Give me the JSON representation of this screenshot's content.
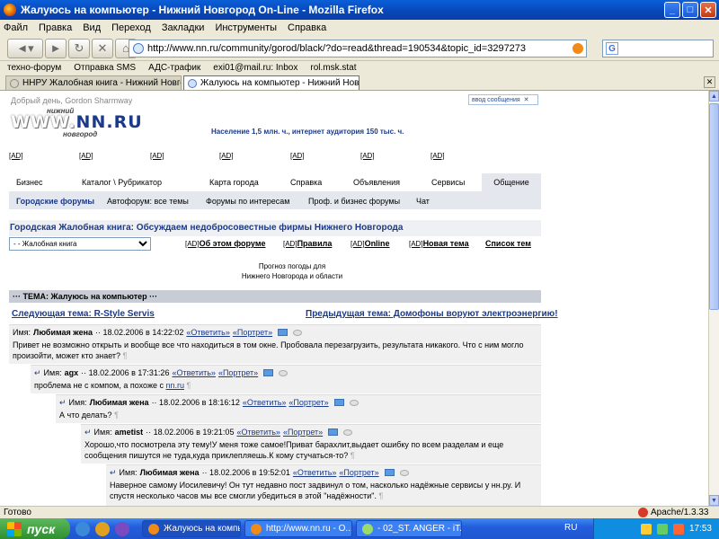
{
  "window": {
    "title": "Жалуюсь на компьютер - Нижний Новгород On-Line - Mozilla Firefox"
  },
  "menu": [
    "Файл",
    "Правка",
    "Вид",
    "Переход",
    "Закладки",
    "Инструменты",
    "Справка"
  ],
  "address": {
    "url": "http://www.nn.ru/community/gorod/black/?do=read&thread=190534&topic_id=3297273"
  },
  "bookmarks": [
    "техно-форум",
    "Отправка SMS",
    "АДС-трафик",
    "exi01@mail.ru: Inbox",
    "rol.msk.stat"
  ],
  "tabs": [
    {
      "label": "ННРУ Жалобная книга - Нижний Новгоро..."
    },
    {
      "label": "Жалуюсь на компьютер - Нижний Новго..."
    }
  ],
  "site": {
    "greeting": "Добрый день, Gordon Sharmway",
    "logo_top": "нижний",
    "logo_main": "WWW.",
    "logo_brand": "NN.RU",
    "logo_bottom": "новгород",
    "online_label": "ввод сообщения",
    "stats": "Население   1,5 млн. ч.,   интернет аудитория   150  тыс. ч.",
    "ad_label": "[AD]",
    "mainnav": [
      "Бизнес",
      "Каталог \\ Рубрикатор",
      "Карта города",
      "Справка",
      "Объявления",
      "Сервисы",
      "Общение"
    ],
    "subnav": [
      "Городские форумы",
      "Автофорум: все темы",
      "Форумы по интересам",
      "Проф. и бизнес форумы",
      "Чат"
    ],
    "forum_title": "Городская Жалобная книга: Обсуждаем недобросовестные фирмы Нижнего Новгорода",
    "forum_select": "- - Жалобная книга",
    "forum_links": [
      {
        "ad": "[AD]",
        "text": "Об этом форуме"
      },
      {
        "ad": "[AD]",
        "text": "Правила"
      },
      {
        "ad": "[AD]",
        "text": "Online"
      },
      {
        "ad": "[AD]",
        "text": "Новая тема"
      },
      {
        "ad": "",
        "text": "Список тем"
      }
    ],
    "weather_line1": "Прогноз погоды для",
    "weather_line2": "Нижнего Новгорода и области",
    "topic": "··· ТЕМА: Жалуюсь на компьютер ···",
    "next_topic": "Следующая тема: R-Style Servis",
    "prev_topic": "Предыдущая тема: Домофоны воруют электроэнергию!"
  },
  "posts": [
    {
      "prefix": "",
      "label": "Имя:",
      "author": "Любимая жена",
      "date": "·· 18.02.2006 в 14:22:02",
      "reply": "«Ответить»",
      "portrait": "«Портрет»",
      "body": "Привет не возможно открыть и вообще все что находиться в том окне. Пробовала перезагрузить, результата никакого. Что с ним могло произойти, может кто знает?",
      "pilcrow": "¶"
    },
    {
      "prefix": "↵",
      "label": "Имя:",
      "author": "agx",
      "date": "·· 18.02.2006 в 17:31:26",
      "reply": "«Ответить»",
      "portrait": "«Портрет»",
      "body": "проблема не с компом, а похоже с",
      "link": "nn.ru",
      "pilcrow": "¶"
    },
    {
      "prefix": "↵",
      "label": "Имя:",
      "author": "Любимая жена",
      "date": "·· 18.02.2006 в 18:16:12",
      "reply": "«Ответить»",
      "portrait": "«Портрет»",
      "body": "А что делать?",
      "pilcrow": "¶"
    },
    {
      "prefix": "↵",
      "label": "Имя:",
      "author": "ametist",
      "date": "·· 18.02.2006 в 19:21:05",
      "reply": "«Ответить»",
      "portrait": "«Портрет»",
      "body": "Хорошо,что посмотрела эту тему!У меня тоже самое!Приват барахлит,выдает ошибку по всем разделам и еще сообщения пишутся не туда,куда приклепляешь.К кому стучаться-то?",
      "pilcrow": "¶"
    },
    {
      "prefix": "↵",
      "label": "Имя:",
      "author": "Любимая жена",
      "date": "·· 18.02.2006 в 19:52:01",
      "reply": "«Ответить»",
      "portrait": "«Портрет»",
      "body": "Наверное самому Иосилевичу! Он тут недавно пост задвинул о том, насколько надёжные сервисы у нн.ру. И спустя несколько часов мы все смогли убедиться в этой \"надёжности\".",
      "pilcrow": "¶"
    }
  ],
  "status": {
    "text": "Готово",
    "server": "Apache/1.3.33"
  },
  "taskbar": {
    "start": "пуск",
    "tasks": [
      "Жалуюсь на компьют...",
      "http://www.nn.ru - O...",
      "- 02_ST. ANGER - iT..."
    ],
    "lang": "RU",
    "clock": "17:53"
  }
}
